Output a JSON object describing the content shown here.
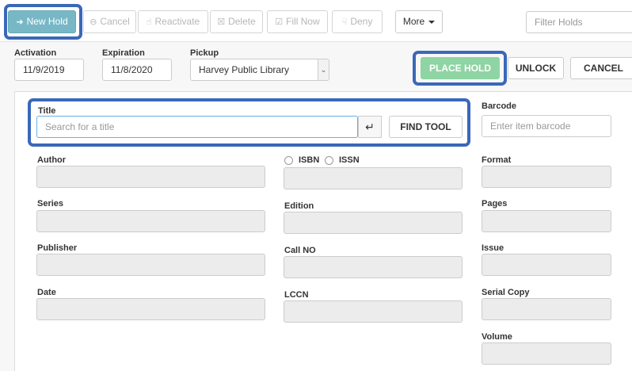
{
  "toolbar": {
    "new_hold": "New Hold",
    "cancel": "Cancel",
    "reactivate": "Reactivate",
    "delete": "Delete",
    "fill_now": "Fill Now",
    "deny": "Deny",
    "more": "More",
    "filter_placeholder": "Filter Holds"
  },
  "header": {
    "activation_label": "Activation",
    "activation_value": "11/9/2019",
    "expiration_label": "Expiration",
    "expiration_value": "11/8/2020",
    "pickup_label": "Pickup",
    "pickup_value": "Harvey Public Library",
    "place_hold": "PLACE HOLD",
    "unlock": "UNLOCK",
    "cancel": "CANCEL"
  },
  "form": {
    "title_label": "Title",
    "title_placeholder": "Search for a title",
    "find_tool": "FIND TOOL",
    "barcode_label": "Barcode",
    "barcode_placeholder": "Enter item barcode",
    "author_label": "Author",
    "isbn_label": "ISBN",
    "issn_label": "ISSN",
    "format_label": "Format",
    "series_label": "Series",
    "edition_label": "Edition",
    "pages_label": "Pages",
    "publisher_label": "Publisher",
    "callno_label": "Call NO",
    "issue_label": "Issue",
    "date_label": "Date",
    "lccn_label": "LCCN",
    "serial_copy_label": "Serial Copy",
    "volume_label": "Volume"
  },
  "icons": {
    "new_hold": "sign-in-icon",
    "cancel": "minus-circle-icon",
    "reactivate": "thumbs-up-icon",
    "delete": "trash-icon",
    "fill_now": "check-square-icon",
    "deny": "thumbs-down-icon",
    "enter": "enter-return-icon"
  },
  "colors": {
    "primary_button": "#78b8c6",
    "place_hold_button": "#8fd4a3",
    "highlight_outline": "#3a68b9",
    "input_focus": "#66afe9"
  }
}
